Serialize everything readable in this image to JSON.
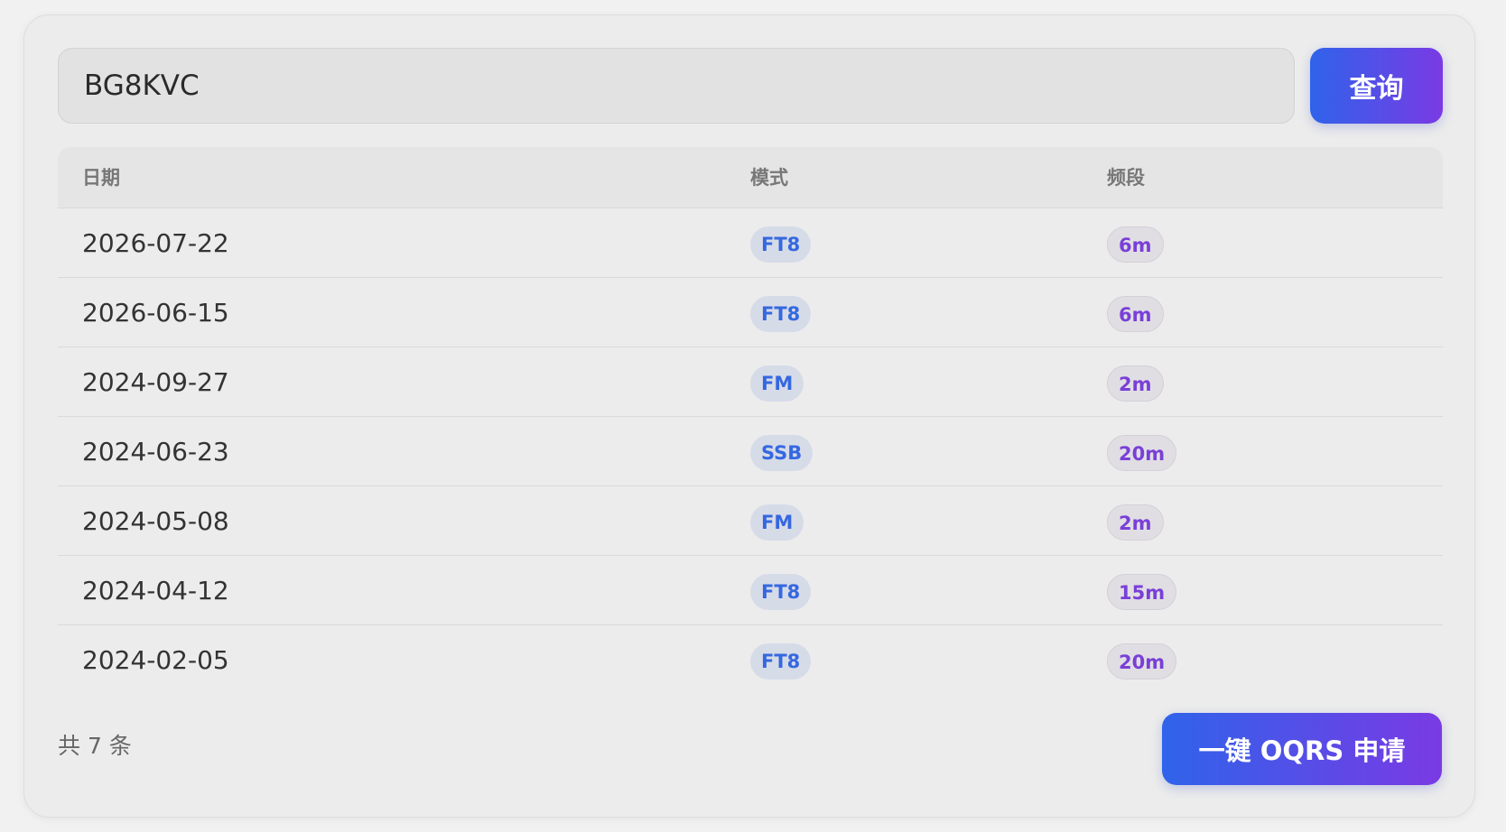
{
  "search": {
    "value": "BG8KVC",
    "button_label": "查询"
  },
  "table": {
    "headers": [
      "日期",
      "模式",
      "频段"
    ],
    "rows": [
      {
        "date": "2026-07-22",
        "mode": "FT8",
        "band": "6m"
      },
      {
        "date": "2026-06-15",
        "mode": "FT8",
        "band": "6m"
      },
      {
        "date": "2024-09-27",
        "mode": "FM",
        "band": "2m"
      },
      {
        "date": "2024-06-23",
        "mode": "SSB",
        "band": "20m"
      },
      {
        "date": "2024-05-08",
        "mode": "FM",
        "band": "2m"
      },
      {
        "date": "2024-04-12",
        "mode": "FT8",
        "band": "15m"
      },
      {
        "date": "2024-02-05",
        "mode": "FT8",
        "band": "20m"
      }
    ]
  },
  "footer": {
    "count_text": "共 7 条",
    "oqrs_button_label": "一键 OQRS 申请"
  },
  "colors": {
    "accent_start": "#2f63ea",
    "accent_end": "#7a3ae4",
    "mode_pill_text": "#3568e0",
    "band_pill_text": "#7a3fd8"
  }
}
